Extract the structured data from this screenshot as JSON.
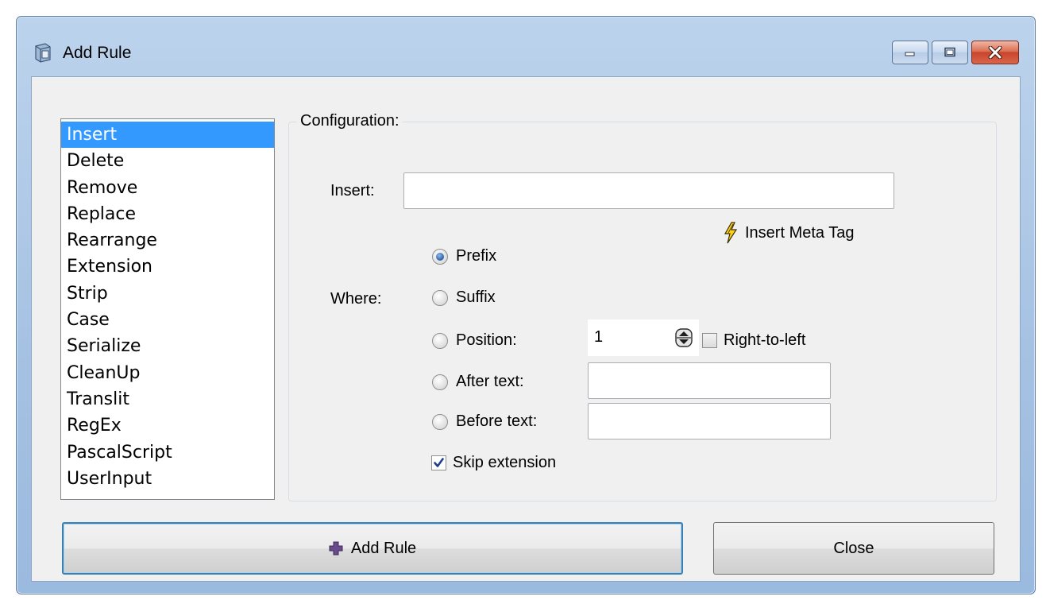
{
  "window": {
    "title": "Add Rule",
    "icon": "app-icon"
  },
  "rule_list": {
    "items": [
      "Insert",
      "Delete",
      "Remove",
      "Replace",
      "Rearrange",
      "Extension",
      "Strip",
      "Case",
      "Serialize",
      "CleanUp",
      "Translit",
      "RegEx",
      "PascalScript",
      "UserInput"
    ],
    "selected": "Insert"
  },
  "config": {
    "group_label": "Configuration:",
    "insert_label": "Insert:",
    "insert_value": "",
    "meta_tag_label": "Insert Meta Tag",
    "where_label": "Where:",
    "options": {
      "prefix": "Prefix",
      "suffix": "Suffix",
      "position": "Position:",
      "after_text": "After text:",
      "before_text": "Before text:"
    },
    "selected_option": "prefix",
    "position_value": "1",
    "right_to_left_label": "Right-to-left",
    "right_to_left_checked": false,
    "after_text_value": "",
    "before_text_value": "",
    "skip_extension_label": "Skip extension",
    "skip_extension_checked": true
  },
  "buttons": {
    "add_rule": "Add Rule",
    "close": "Close"
  }
}
